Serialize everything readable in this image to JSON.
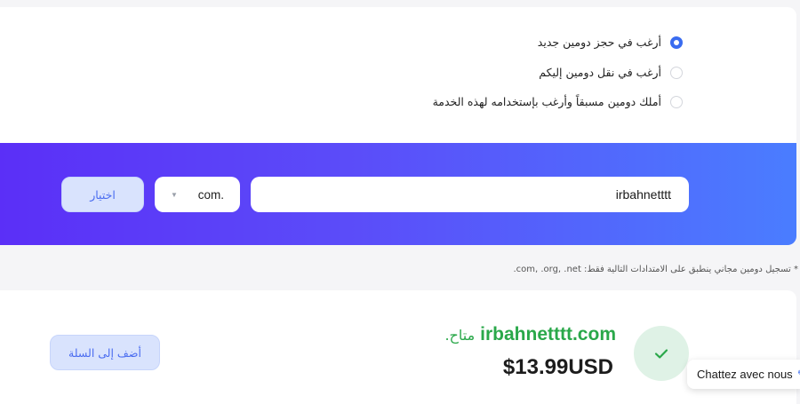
{
  "options": {
    "register_new": "أرغب في حجز دومين جديد",
    "transfer": "أرغب في نقل دومين إليكم",
    "own_domain": "أملك دومين مسبقاً وأرغب بإستخدامه لهذه الخدمة",
    "selected": "register_new"
  },
  "search": {
    "domain_value": "irbahnetttt",
    "tld_selected": "com.",
    "choose_label": "اختيار"
  },
  "note": "* تسجيل دومين مجاني ينطبق على الامتدادات التالية فقط: com, .org, .net.",
  "result": {
    "domain": "irbahnetttt.com",
    "status": "متاح.",
    "price": "$13.99USD",
    "add_to_cart_label": "أضف إلى السلة"
  },
  "chat": {
    "label": "Chattez avec nous"
  },
  "colors": {
    "accent": "#3a6cf0",
    "gradient_start": "#5b2ff7",
    "gradient_end": "#4a7dff",
    "available_green": "#2aa84a"
  }
}
